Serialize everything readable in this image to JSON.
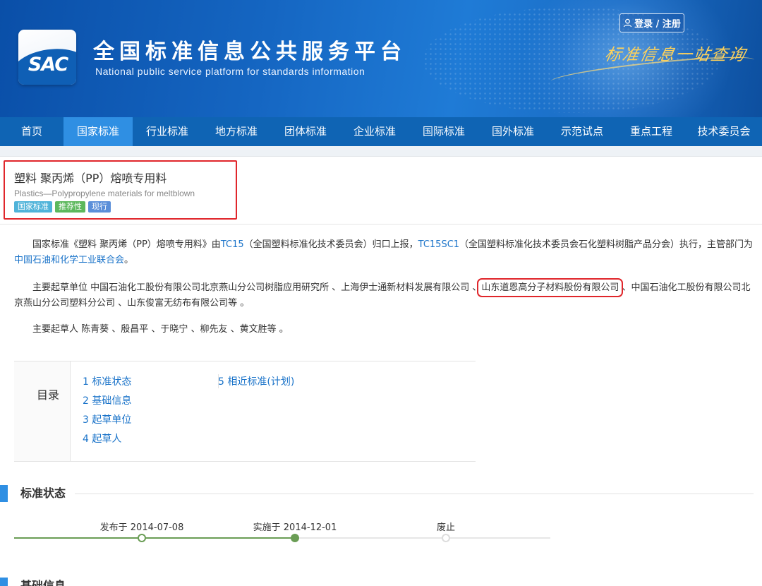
{
  "header": {
    "logo_text": "SAC",
    "title": "全国标准信息公共服务平台",
    "subtitle": "National public service platform  for standards information",
    "login_label": "登录 / 注册",
    "slogan": "标准信息一站查询"
  },
  "nav": {
    "items": [
      "首页",
      "国家标准",
      "行业标准",
      "地方标准",
      "团体标准",
      "企业标准",
      "国际标准",
      "国外标准",
      "示范试点",
      "重点工程",
      "技术委员会"
    ],
    "active_index": 1
  },
  "standard": {
    "title": "塑料 聚丙烯（PP）熔喷专用料",
    "title_en": "Plastics—Polypropylene materials for meltblown",
    "tags": [
      {
        "label": "国家标准",
        "color": "#4fb3d9"
      },
      {
        "label": "推荐性",
        "color": "#5cb85c"
      },
      {
        "label": "现行",
        "color": "#5b8fd9"
      }
    ]
  },
  "intro": {
    "p1_a": "国家标准《塑料 聚丙烯（PP）熔喷专用料》由",
    "p1_tc": "TC15",
    "p1_b": "（全国塑料标准化技术委员会）归口上报，",
    "p1_sc": "TC15SC1",
    "p1_c": "（全国塑料标准化技术委员会石化塑料树脂产品分会）执行，主管部门为",
    "p1_dept": "中国石油和化学工业联合会",
    "p1_end": "。",
    "p2_a": "主要起草单位 中国石油化工股份有限公司北京燕山分公司树脂应用研究所 、上海伊士通新材料发展有限公司 、",
    "p2_boxed": "山东道恩高分子材料股份有限公司",
    "p2_b": " 、中国石油化工股份有限公司北京燕山分公司塑料分公司 、山东俊富无纺布有限公司等 。",
    "p3": "主要起草人 陈青葵 、殷昌平 、于晓宁 、柳先友 、黄文胜等 。"
  },
  "toc": {
    "label": "目录",
    "col1": [
      "1  标准状态",
      "2  基础信息",
      "3  起草单位",
      "4  起草人"
    ],
    "col2": [
      "5  相近标准(计划)"
    ]
  },
  "sections": {
    "status": "标准状态",
    "basic": "基础信息"
  },
  "timeline": [
    {
      "label": "发布于 2014-07-08",
      "state": "done"
    },
    {
      "label": "实施于 2014-12-01",
      "state": "current"
    },
    {
      "label": "废止",
      "state": "pending"
    }
  ],
  "colors": {
    "nav_bg": "#0f64b4",
    "nav_active": "#2f8fe3",
    "link": "#1a73c9",
    "highlight_box": "#e0262b",
    "timeline_done": "#6a9d55"
  }
}
